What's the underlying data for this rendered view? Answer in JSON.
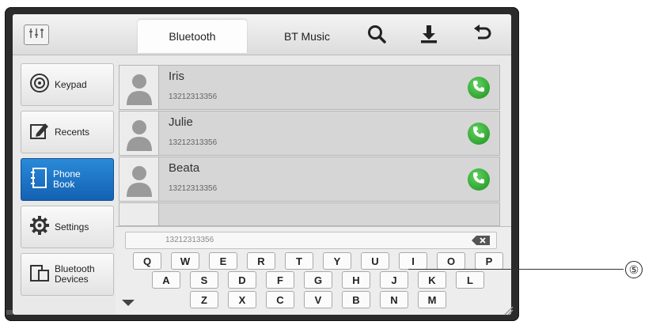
{
  "tabs": [
    {
      "label": "Bluetooth",
      "active": true
    },
    {
      "label": "BT Music",
      "active": false
    }
  ],
  "top_icons": [
    "equalizer-icon",
    "search-icon",
    "download-icon",
    "back-icon"
  ],
  "sidebar": {
    "items": [
      {
        "label": "Keypad",
        "icon": "keypad-icon",
        "active": false
      },
      {
        "label": "Recents",
        "icon": "recents-icon",
        "active": false
      },
      {
        "label": "Phone Book",
        "icon": "phonebook-icon",
        "active": true
      },
      {
        "label": "Settings",
        "icon": "gear-icon",
        "active": false
      },
      {
        "label": "Bluetooth Devices",
        "icon": "devices-icon",
        "active": false
      }
    ]
  },
  "contacts": [
    {
      "name": "Iris",
      "number": "13212313356"
    },
    {
      "name": "Julie",
      "number": "13212313356"
    },
    {
      "name": "Beata",
      "number": "13212313356"
    }
  ],
  "keyboard": {
    "input_value": "13212313356",
    "row1": [
      "Q",
      "W",
      "E",
      "R",
      "T",
      "Y",
      "U",
      "I",
      "O",
      "P"
    ],
    "row2": [
      "A",
      "S",
      "D",
      "F",
      "G",
      "H",
      "J",
      "K",
      "L"
    ],
    "row3": [
      "Z",
      "X",
      "C",
      "V",
      "B",
      "N",
      "M"
    ]
  },
  "callout": {
    "label": "⑤"
  },
  "colors": {
    "active_blue": "#1f73c4",
    "call_green": "#2fa72f",
    "bezel": "#2b2b2b"
  }
}
